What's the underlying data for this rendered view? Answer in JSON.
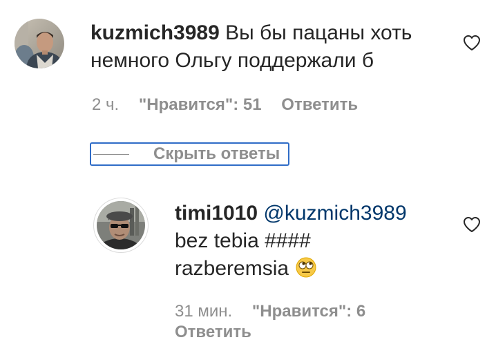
{
  "comment": {
    "username": "kuzmich3989",
    "text": "Вы бы пацаны хоть немного Ольгу поддержали б",
    "time": "2 ч.",
    "likes": "\"Нравится\": 51",
    "reply_label": "Ответить",
    "avatar_icon": "user-avatar"
  },
  "replies_toggle": {
    "label": "Скрыть ответы"
  },
  "reply": {
    "username": "timi1010",
    "mention": "@kuzmich3989",
    "text_line1": "bez tebia ####",
    "text_line2": "razberemsia",
    "emoji_icon": "rolling-eyes-emoji",
    "time": "31 мин.",
    "likes": "\"Нравится\": 6",
    "reply_label": "Ответить",
    "avatar_icon": "user-avatar"
  },
  "icons": {
    "like": "heart-outline-icon"
  },
  "colors": {
    "text": "#262626",
    "muted": "#8e8e8e",
    "mention": "#00376b",
    "focus_outline": "#2f6cc7"
  }
}
